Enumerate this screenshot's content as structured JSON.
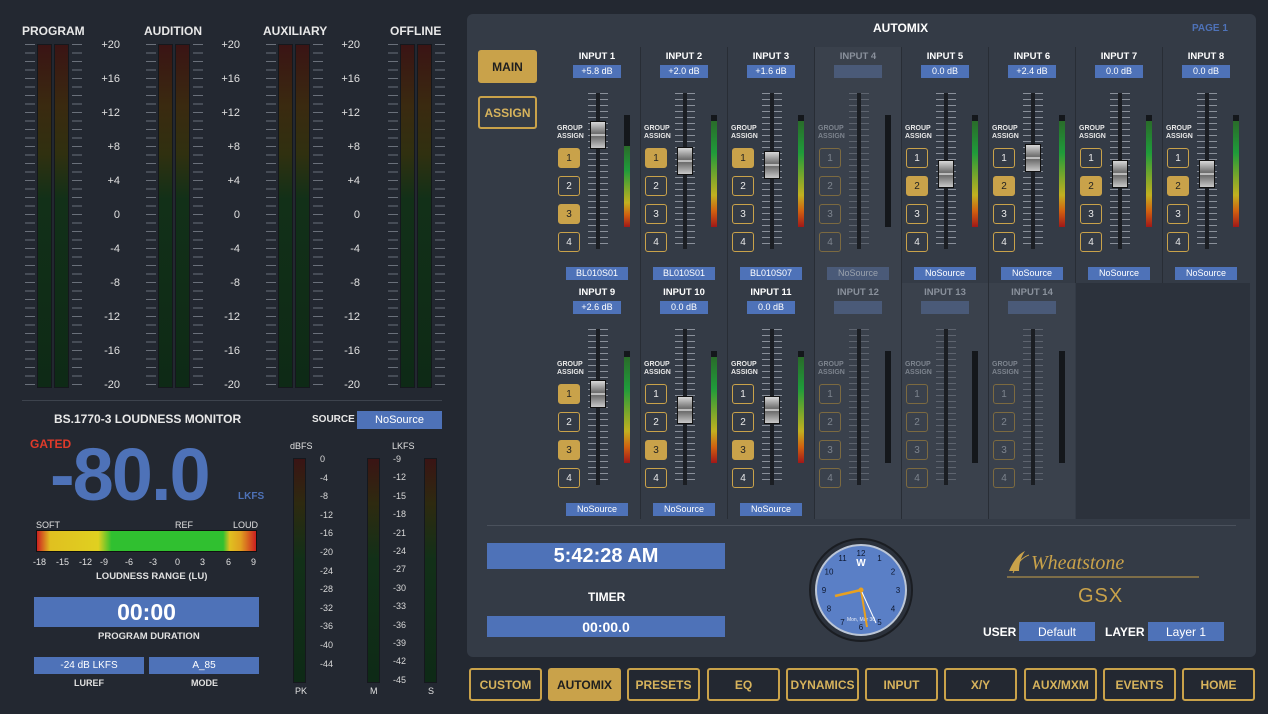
{
  "meters": {
    "labels": [
      "PROGRAM",
      "AUDITION",
      "AUXILIARY",
      "OFFLINE"
    ],
    "scale": [
      "+20",
      "+16",
      "+12",
      "+8",
      "+4",
      "0",
      "-4",
      "-8",
      "-12",
      "-16",
      "-20"
    ]
  },
  "loudness": {
    "title": "BS.1770-3 LOUDNESS MONITOR",
    "source_label": "SOURCE",
    "source_value": "NoSource",
    "gated": "GATED",
    "value": "-80.0",
    "unit": "LKFS",
    "soft": "SOFT",
    "ref": "REF",
    "loud": "LOUD",
    "range_ticks": [
      "-18",
      "-15",
      "-12",
      "-9",
      "-6",
      "-3",
      "0",
      "3",
      "6",
      "9"
    ],
    "range_label": "LOUDNESS RANGE (LU)",
    "duration": "00:00",
    "duration_label": "PROGRAM DURATION",
    "luref_value": "-24 dB LKFS",
    "luref_label": "LUREF",
    "mode_value": "A_85",
    "mode_label": "MODE",
    "dbfs_label": "dBFS",
    "dbfs_scale": [
      "0",
      "-4",
      "-8",
      "-12",
      "-16",
      "-20",
      "-24",
      "-28",
      "-32",
      "-36",
      "-40",
      "-44"
    ],
    "lkfs_label": "LKFS",
    "lkfs_scale": [
      "-9",
      "-12",
      "-15",
      "-18",
      "-21",
      "-24",
      "-27",
      "-30",
      "-33",
      "-36",
      "-39",
      "-42",
      "-45"
    ],
    "pk": "PK",
    "m": "M",
    "s": "S"
  },
  "automix": {
    "title": "AUTOMIX",
    "page": "PAGE 1",
    "main_button": "MAIN",
    "assign_button": "ASSIGN",
    "group_assign": "GROUP ASSIGN",
    "inputs": [
      {
        "name": "INPUT 1",
        "gain": "+5.8 dB",
        "source": "BL010S01",
        "active": true,
        "groups": [
          true,
          false,
          true,
          false
        ],
        "fader": 0.22,
        "level": 0.72
      },
      {
        "name": "INPUT 2",
        "gain": "+2.0 dB",
        "source": "BL010S01",
        "active": true,
        "groups": [
          true,
          false,
          false,
          false
        ],
        "fader": 0.42,
        "level": 0.95
      },
      {
        "name": "INPUT 3",
        "gain": "+1.6 dB",
        "source": "BL010S07",
        "active": true,
        "groups": [
          true,
          false,
          false,
          false
        ],
        "fader": 0.45,
        "level": 0.95
      },
      {
        "name": "INPUT 4",
        "gain": "",
        "source": "NoSource",
        "active": false,
        "groups": [
          false,
          false,
          false,
          false
        ],
        "fader": 0.0,
        "level": 0.95
      },
      {
        "name": "INPUT 5",
        "gain": "0.0 dB",
        "source": "NoSource",
        "active": true,
        "groups": [
          false,
          true,
          false,
          false
        ],
        "fader": 0.52,
        "level": 0.95
      },
      {
        "name": "INPUT 6",
        "gain": "+2.4 dB",
        "source": "NoSource",
        "active": true,
        "groups": [
          false,
          true,
          false,
          false
        ],
        "fader": 0.4,
        "level": 0.95
      },
      {
        "name": "INPUT 7",
        "gain": "0.0 dB",
        "source": "NoSource",
        "active": true,
        "groups": [
          false,
          true,
          false,
          false
        ],
        "fader": 0.52,
        "level": 0.95
      },
      {
        "name": "INPUT 8",
        "gain": "0.0 dB",
        "source": "NoSource",
        "active": true,
        "groups": [
          false,
          true,
          false,
          false
        ],
        "fader": 0.52,
        "level": 0.95
      },
      {
        "name": "INPUT 9",
        "gain": "+2.6 dB",
        "source": "NoSource",
        "active": true,
        "groups": [
          true,
          false,
          true,
          false
        ],
        "fader": 0.4,
        "level": 0.95
      },
      {
        "name": "INPUT 10",
        "gain": "0.0 dB",
        "source": "NoSource",
        "active": true,
        "groups": [
          false,
          false,
          true,
          false
        ],
        "fader": 0.52,
        "level": 0.95
      },
      {
        "name": "INPUT 11",
        "gain": "0.0 dB",
        "source": "NoSource",
        "active": true,
        "groups": [
          false,
          false,
          true,
          false
        ],
        "fader": 0.52,
        "level": 0.95
      },
      {
        "name": "INPUT 12",
        "gain": "",
        "source": "",
        "active": false,
        "groups": [
          false,
          false,
          false,
          false
        ],
        "fader": 0.0,
        "level": 0.95
      },
      {
        "name": "INPUT 13",
        "gain": "",
        "source": "",
        "active": false,
        "groups": [
          false,
          false,
          false,
          false
        ],
        "fader": 0.0,
        "level": 0.95
      },
      {
        "name": "INPUT 14",
        "gain": "",
        "source": "",
        "active": false,
        "groups": [
          false,
          false,
          false,
          false
        ],
        "fader": 0.0,
        "level": 0.95
      }
    ],
    "group_numbers": [
      "1",
      "2",
      "3",
      "4"
    ],
    "clock_time": "5:42:28 AM",
    "timer_label": "TIMER",
    "timer_value": "00:00.0",
    "clock_face_date": "Mon, Mar 30",
    "brand": "Wheatstone",
    "model": "GSX",
    "user_label": "USER",
    "user_value": "Default",
    "layer_label": "LAYER",
    "layer_value": "Layer 1"
  },
  "nav": [
    {
      "label": "CUSTOM",
      "active": false
    },
    {
      "label": "AUTOMIX",
      "active": true
    },
    {
      "label": "PRESETS",
      "active": false
    },
    {
      "label": "EQ",
      "active": false
    },
    {
      "label": "DYNAMICS",
      "active": false
    },
    {
      "label": "INPUT",
      "active": false
    },
    {
      "label": "X/Y",
      "active": false
    },
    {
      "label": "AUX/MXM",
      "active": false
    },
    {
      "label": "EVENTS",
      "active": false
    },
    {
      "label": "HOME",
      "active": false
    }
  ],
  "colors": {
    "accent_gold": "#c9a24a",
    "field_blue": "#4e72b8",
    "panel": "#343b46",
    "background": "#232831",
    "gated_red": "#e03a2a"
  }
}
